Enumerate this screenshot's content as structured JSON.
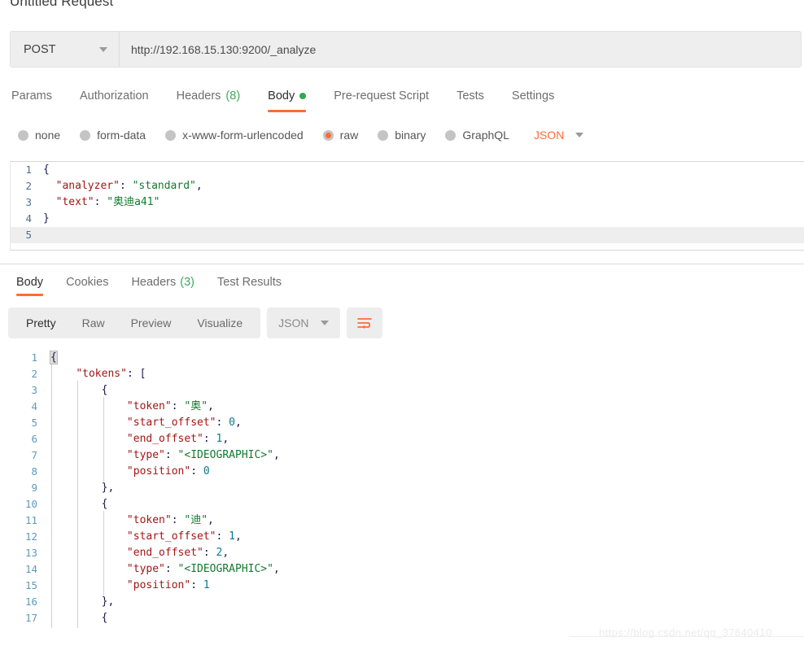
{
  "request": {
    "title": "Untitled Request",
    "method": "POST",
    "url": "http://192.168.15.130:9200/_analyze",
    "tabs": [
      {
        "label": "Params",
        "count": "",
        "dot": false,
        "active": false
      },
      {
        "label": "Authorization",
        "count": "",
        "dot": false,
        "active": false
      },
      {
        "label": "Headers",
        "count": "(8)",
        "dot": false,
        "active": false
      },
      {
        "label": "Body",
        "count": "",
        "dot": true,
        "active": true
      },
      {
        "label": "Pre-request Script",
        "count": "",
        "dot": false,
        "active": false
      },
      {
        "label": "Tests",
        "count": "",
        "dot": false,
        "active": false
      },
      {
        "label": "Settings",
        "count": "",
        "dot": false,
        "active": false
      }
    ],
    "body_modes": [
      {
        "label": "none",
        "selected": false
      },
      {
        "label": "form-data",
        "selected": false
      },
      {
        "label": "x-www-form-urlencoded",
        "selected": false
      },
      {
        "label": "raw",
        "selected": true
      },
      {
        "label": "binary",
        "selected": false
      },
      {
        "label": "GraphQL",
        "selected": false
      }
    ],
    "raw_format": "JSON",
    "body_lines": [
      {
        "num": "1",
        "active": false,
        "tokens": [
          {
            "t": "{",
            "c": "p"
          }
        ]
      },
      {
        "num": "2",
        "active": false,
        "tokens": [
          {
            "t": "  ",
            "c": "p"
          },
          {
            "t": "\"analyzer\"",
            "c": "k"
          },
          {
            "t": ": ",
            "c": "p"
          },
          {
            "t": "\"standard\"",
            "c": "s"
          },
          {
            "t": ",",
            "c": "p"
          }
        ]
      },
      {
        "num": "3",
        "active": false,
        "tokens": [
          {
            "t": "  ",
            "c": "p"
          },
          {
            "t": "\"text\"",
            "c": "k"
          },
          {
            "t": ": ",
            "c": "p"
          },
          {
            "t": "\"奥迪a41\"",
            "c": "s"
          }
        ]
      },
      {
        "num": "4",
        "active": false,
        "tokens": [
          {
            "t": "}",
            "c": "p"
          }
        ]
      },
      {
        "num": "5",
        "active": true,
        "tokens": []
      }
    ]
  },
  "response": {
    "tabs": [
      {
        "label": "Body",
        "count": "",
        "active": true
      },
      {
        "label": "Cookies",
        "count": "",
        "active": false
      },
      {
        "label": "Headers",
        "count": "(3)",
        "active": false
      },
      {
        "label": "Test Results",
        "count": "",
        "active": false
      }
    ],
    "view_modes": [
      {
        "label": "Pretty",
        "active": true
      },
      {
        "label": "Raw",
        "active": false
      },
      {
        "label": "Preview",
        "active": false
      },
      {
        "label": "Visualize",
        "active": false
      }
    ],
    "format": "JSON",
    "wrap_icon": "word-wrap-icon",
    "body_lines": [
      {
        "num": "1",
        "guides": [],
        "tokens": [
          {
            "t": "{",
            "c": "bm"
          }
        ]
      },
      {
        "num": "2",
        "guides": [
          0
        ],
        "tokens": [
          {
            "t": "    ",
            "c": "p"
          },
          {
            "t": "\"tokens\"",
            "c": "k"
          },
          {
            "t": ": ",
            "c": "p"
          },
          {
            "t": "[",
            "c": "p"
          }
        ]
      },
      {
        "num": "3",
        "guides": [
          0,
          1
        ],
        "tokens": [
          {
            "t": "        {",
            "c": "p"
          }
        ]
      },
      {
        "num": "4",
        "guides": [
          0,
          1,
          2
        ],
        "tokens": [
          {
            "t": "            ",
            "c": "p"
          },
          {
            "t": "\"token\"",
            "c": "k"
          },
          {
            "t": ": ",
            "c": "p"
          },
          {
            "t": "\"奥\"",
            "c": "s"
          },
          {
            "t": ",",
            "c": "p"
          }
        ]
      },
      {
        "num": "5",
        "guides": [
          0,
          1,
          2
        ],
        "tokens": [
          {
            "t": "            ",
            "c": "p"
          },
          {
            "t": "\"start_offset\"",
            "c": "k"
          },
          {
            "t": ": ",
            "c": "p"
          },
          {
            "t": "0",
            "c": "n"
          },
          {
            "t": ",",
            "c": "p"
          }
        ]
      },
      {
        "num": "6",
        "guides": [
          0,
          1,
          2
        ],
        "tokens": [
          {
            "t": "            ",
            "c": "p"
          },
          {
            "t": "\"end_offset\"",
            "c": "k"
          },
          {
            "t": ": ",
            "c": "p"
          },
          {
            "t": "1",
            "c": "n"
          },
          {
            "t": ",",
            "c": "p"
          }
        ]
      },
      {
        "num": "7",
        "guides": [
          0,
          1,
          2
        ],
        "tokens": [
          {
            "t": "            ",
            "c": "p"
          },
          {
            "t": "\"type\"",
            "c": "k"
          },
          {
            "t": ": ",
            "c": "p"
          },
          {
            "t": "\"<IDEOGRAPHIC>\"",
            "c": "s"
          },
          {
            "t": ",",
            "c": "p"
          }
        ]
      },
      {
        "num": "8",
        "guides": [
          0,
          1,
          2
        ],
        "tokens": [
          {
            "t": "            ",
            "c": "p"
          },
          {
            "t": "\"position\"",
            "c": "k"
          },
          {
            "t": ": ",
            "c": "p"
          },
          {
            "t": "0",
            "c": "n"
          }
        ]
      },
      {
        "num": "9",
        "guides": [
          0,
          1
        ],
        "tokens": [
          {
            "t": "        },",
            "c": "p"
          }
        ]
      },
      {
        "num": "10",
        "guides": [
          0,
          1
        ],
        "tokens": [
          {
            "t": "        {",
            "c": "p"
          }
        ]
      },
      {
        "num": "11",
        "guides": [
          0,
          1,
          2
        ],
        "tokens": [
          {
            "t": "            ",
            "c": "p"
          },
          {
            "t": "\"token\"",
            "c": "k"
          },
          {
            "t": ": ",
            "c": "p"
          },
          {
            "t": "\"迪\"",
            "c": "s"
          },
          {
            "t": ",",
            "c": "p"
          }
        ]
      },
      {
        "num": "12",
        "guides": [
          0,
          1,
          2
        ],
        "tokens": [
          {
            "t": "            ",
            "c": "p"
          },
          {
            "t": "\"start_offset\"",
            "c": "k"
          },
          {
            "t": ": ",
            "c": "p"
          },
          {
            "t": "1",
            "c": "n"
          },
          {
            "t": ",",
            "c": "p"
          }
        ]
      },
      {
        "num": "13",
        "guides": [
          0,
          1,
          2
        ],
        "tokens": [
          {
            "t": "            ",
            "c": "p"
          },
          {
            "t": "\"end_offset\"",
            "c": "k"
          },
          {
            "t": ": ",
            "c": "p"
          },
          {
            "t": "2",
            "c": "n"
          },
          {
            "t": ",",
            "c": "p"
          }
        ]
      },
      {
        "num": "14",
        "guides": [
          0,
          1,
          2
        ],
        "tokens": [
          {
            "t": "            ",
            "c": "p"
          },
          {
            "t": "\"type\"",
            "c": "k"
          },
          {
            "t": ": ",
            "c": "p"
          },
          {
            "t": "\"<IDEOGRAPHIC>\"",
            "c": "s"
          },
          {
            "t": ",",
            "c": "p"
          }
        ]
      },
      {
        "num": "15",
        "guides": [
          0,
          1,
          2
        ],
        "tokens": [
          {
            "t": "            ",
            "c": "p"
          },
          {
            "t": "\"position\"",
            "c": "k"
          },
          {
            "t": ": ",
            "c": "p"
          },
          {
            "t": "1",
            "c": "n"
          }
        ]
      },
      {
        "num": "16",
        "guides": [
          0,
          1
        ],
        "tokens": [
          {
            "t": "        },",
            "c": "p"
          }
        ]
      },
      {
        "num": "17",
        "guides": [
          0,
          1
        ],
        "tokens": [
          {
            "t": "        {",
            "c": "p"
          }
        ]
      }
    ]
  },
  "watermark": "https://blog.csdn.net/qq_37640410",
  "colors": {
    "accent": "#ff6c37",
    "green": "#2eab4f",
    "json_key": "#a31515",
    "json_string": "#127a2e",
    "json_number": "#0b7a8c"
  }
}
